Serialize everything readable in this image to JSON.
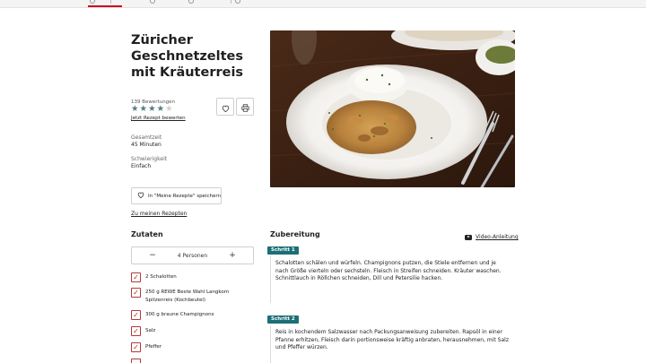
{
  "recipe": {
    "title": "Züricher Geschnetzeltes mit Kräuterreis",
    "rating_count": "139 Bewertungen",
    "rating": 3.5,
    "rating_max": 5,
    "rate_link": "Jetzt Rezept bewerten",
    "total_time_label": "Gesamtzeit",
    "total_time_value": "45 Minuten",
    "difficulty_label": "Schwierigkeit",
    "difficulty_value": "Einfach",
    "save_button": "In \"Meine Rezepte\" speichern",
    "my_recipes_link": "Zu meinen Rezepten"
  },
  "icons": {
    "favorite": "heart-icon",
    "print": "printer-icon",
    "video": "youtube-icon"
  },
  "ingredients": {
    "heading": "Zutaten",
    "portions": "4 Personen",
    "minus": "−",
    "plus": "+",
    "items": [
      {
        "label": "2 Schalotten",
        "checked": true
      },
      {
        "label": "250 g REWE Beste Wahl Langkorn Spitzenreis (Kochbeutel)",
        "checked": true
      },
      {
        "label": "300 g braune Champignons",
        "checked": true
      },
      {
        "label": "Salz",
        "checked": true
      },
      {
        "label": "Pfeffer",
        "checked": true
      }
    ]
  },
  "preparation": {
    "heading": "Zubereitung",
    "video_link": "Video-Anleitung",
    "steps": [
      {
        "badge": "Schritt 1",
        "text": "Schalotten schälen und würfeln. Champignons putzen, die Stiele entfernen und je nach Größe vierteln oder sechsteln. Fleisch in Streifen schneiden. Kräuter waschen. Schnittlauch in Röllchen schneiden, Dill und Petersilie hacken."
      },
      {
        "badge": "Schritt 2",
        "text": "Reis in kochendem Salzwasser nach Packungsanweisung zubereiten. Rapsöl in einer Pfanne erhitzen, Fleisch darin portionsweise kräftig anbraten, herausnehmen, mit Salz und Pfeffer würzen."
      }
    ]
  },
  "colors": {
    "accent_red": "#cc071e",
    "step_teal": "#1d6f76",
    "star": "#4f7d83"
  }
}
